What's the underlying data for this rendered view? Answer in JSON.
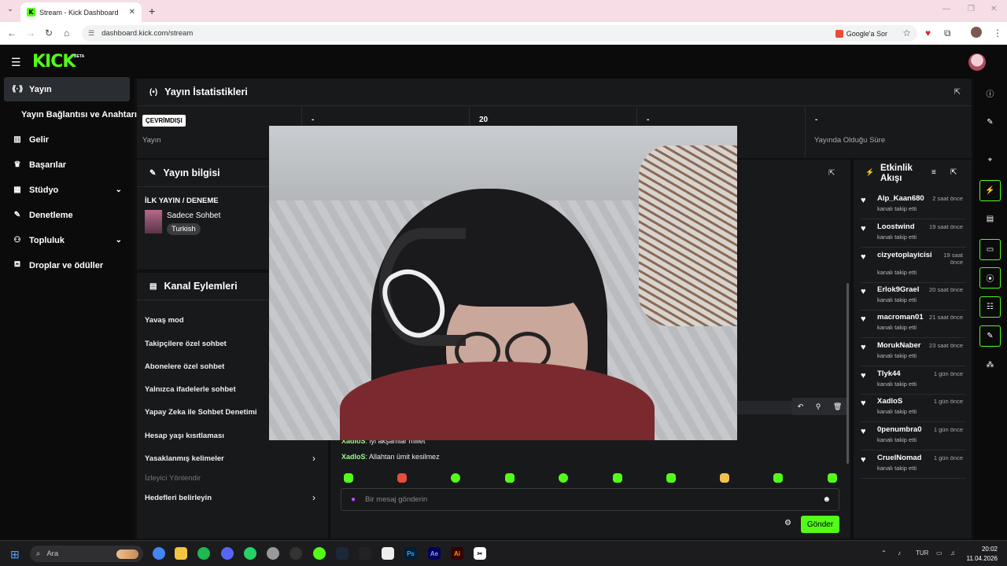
{
  "browser": {
    "tab_title": "Stream - Kick Dashboard",
    "tab_icon": "K",
    "url": "dashboard.kick.com/stream",
    "google_ask": "Google'a Sor"
  },
  "header": {
    "logo": "KICK",
    "beta": "BETA"
  },
  "sidebar": {
    "items": [
      {
        "icon": "⟪·⟫",
        "label": "Yayın",
        "active": true
      },
      {
        "icon": "",
        "label": "Yayın Bağlantısı ve Anahtarı"
      },
      {
        "icon": "▥",
        "label": "Gelir"
      },
      {
        "icon": "♛",
        "label": "Başarılar"
      },
      {
        "icon": "▦",
        "label": "Stüdyo",
        "chevron": "⌄"
      },
      {
        "icon": "✎",
        "label": "Denetleme"
      },
      {
        "icon": "⚇",
        "label": "Topluluk",
        "chevron": "⌄"
      },
      {
        "icon": "⛾",
        "label": "Droplar ve ödüller"
      }
    ]
  },
  "stats": {
    "title": "Yayın İstatistikleri",
    "offline_badge": "ÇEVRİMDIŞI",
    "cells": [
      {
        "value": "",
        "label": "Yayın"
      },
      {
        "value": "-",
        "label": ""
      },
      {
        "value": "20",
        "label": ""
      },
      {
        "value": "-",
        "label": ""
      },
      {
        "value": "-",
        "label": "Yayında Olduğu Süre"
      }
    ]
  },
  "stream_info": {
    "title": "Yayın bilgisi",
    "stream_title": "İLK YAYIN / DENEME",
    "category": "Sadece Sohbet",
    "tag": "Turkish"
  },
  "channel_actions": {
    "title": "Kanal Eylemleri",
    "items": [
      "Yavaş mod",
      "Takipçilere özel sohbet",
      "Abonelere özel sohbet",
      "Yalnızca ifadelerle sohbet",
      "Yapay Zeka ile Sohbet Denetimi",
      "Hesap yaşı kısıtlaması",
      "Yasaklanmış kelimeler",
      "İzleyici Yönlendir",
      "Hedefleri belirleyin"
    ]
  },
  "chat": {
    "messages": [
      {
        "user": "XadloS",
        "text": "iyi akşamlar millet"
      },
      {
        "user": "XadloS",
        "text": "Allahtan ümit kesilmez"
      }
    ],
    "placeholder": "Bir mesaj gönderin",
    "send": "Gönder"
  },
  "activity": {
    "title_line1": "Etkinlik",
    "title_line2": "Akışı",
    "items": [
      {
        "name": "Alp_Kaan680",
        "time": "2 saat önce",
        "action": "kanalı takip etti"
      },
      {
        "name": "Loostwind",
        "time": "19 saat önce",
        "action": "kanalı takip etti"
      },
      {
        "name": "cizyetoplayicisi",
        "time": "19 saat\nönce",
        "action": "kanalı takip etti"
      },
      {
        "name": "Erlok9Grael",
        "time": "20 saat önce",
        "action": "kanalı takip etti"
      },
      {
        "name": "macroman01",
        "time": "21 saat önce",
        "action": "kanalı takip etti"
      },
      {
        "name": "MorukNaber",
        "time": "23 saat önce",
        "action": "kanalı takip etti"
      },
      {
        "name": "Tlyk44",
        "time": "1 gün önce",
        "action": "kanalı takip etti"
      },
      {
        "name": "XadloS",
        "time": "1 gün önce",
        "action": "kanalı takip etti"
      },
      {
        "name": "0penumbra0",
        "time": "1 gün önce",
        "action": "kanalı takip etti"
      },
      {
        "name": "CruelNomad",
        "time": "1 gün önce",
        "action": "kanalı takip etti"
      }
    ]
  },
  "taskbar": {
    "search": "Ara",
    "lang": "TUR",
    "time": "20:02",
    "date": "11.04.2026"
  },
  "colors": {
    "accent": "#53fc18",
    "panel": "#18191b",
    "background": "#0f0f10"
  }
}
